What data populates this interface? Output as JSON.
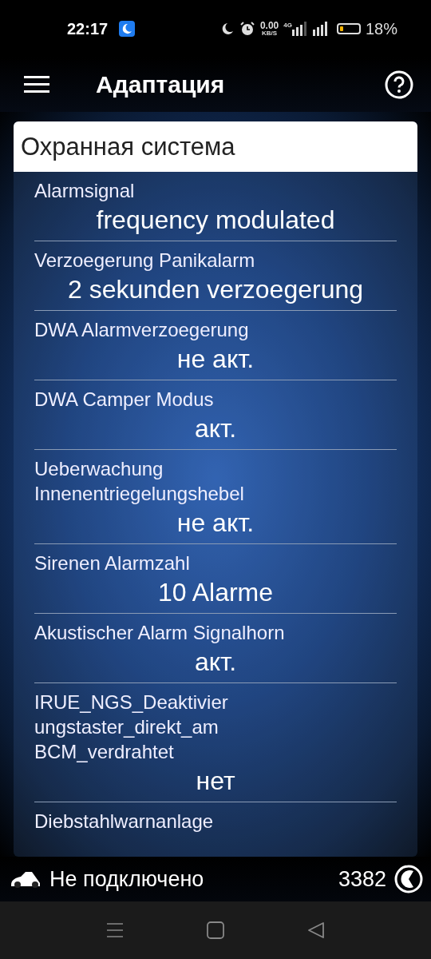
{
  "status_bar": {
    "time": "22:17",
    "net_speed": "0.00",
    "net_unit": "KB/S",
    "network": "4G",
    "battery": {
      "text": "18%",
      "level": 0.18
    }
  },
  "app_bar": {
    "title": "Адаптация"
  },
  "section": {
    "title": "Охранная система",
    "items": [
      {
        "label": "Alarmsignal",
        "value": "frequency modulated"
      },
      {
        "label": "Verzoegerung Panikalarm",
        "value": "2 sekunden verzoegerung"
      },
      {
        "label": "DWA Alarmverzoegerung",
        "value": "не акт."
      },
      {
        "label": "DWA Camper Modus",
        "value": "акт."
      },
      {
        "label": "Ueberwachung Innenentriegelungshebel",
        "value": "не акт."
      },
      {
        "label": "Sirenen Alarmzahl",
        "value": "10 Alarme"
      },
      {
        "label": "Akustischer Alarm Signalhorn",
        "value": "акт."
      },
      {
        "label": "IRUE_NGS_Deaktivier ungstaster_direkt_am BCM_verdrahtet",
        "value": "нет"
      },
      {
        "label": "Diebstahlwarnanlage"
      }
    ]
  },
  "footer": {
    "connection": "Не подключено",
    "counter": "3382"
  }
}
